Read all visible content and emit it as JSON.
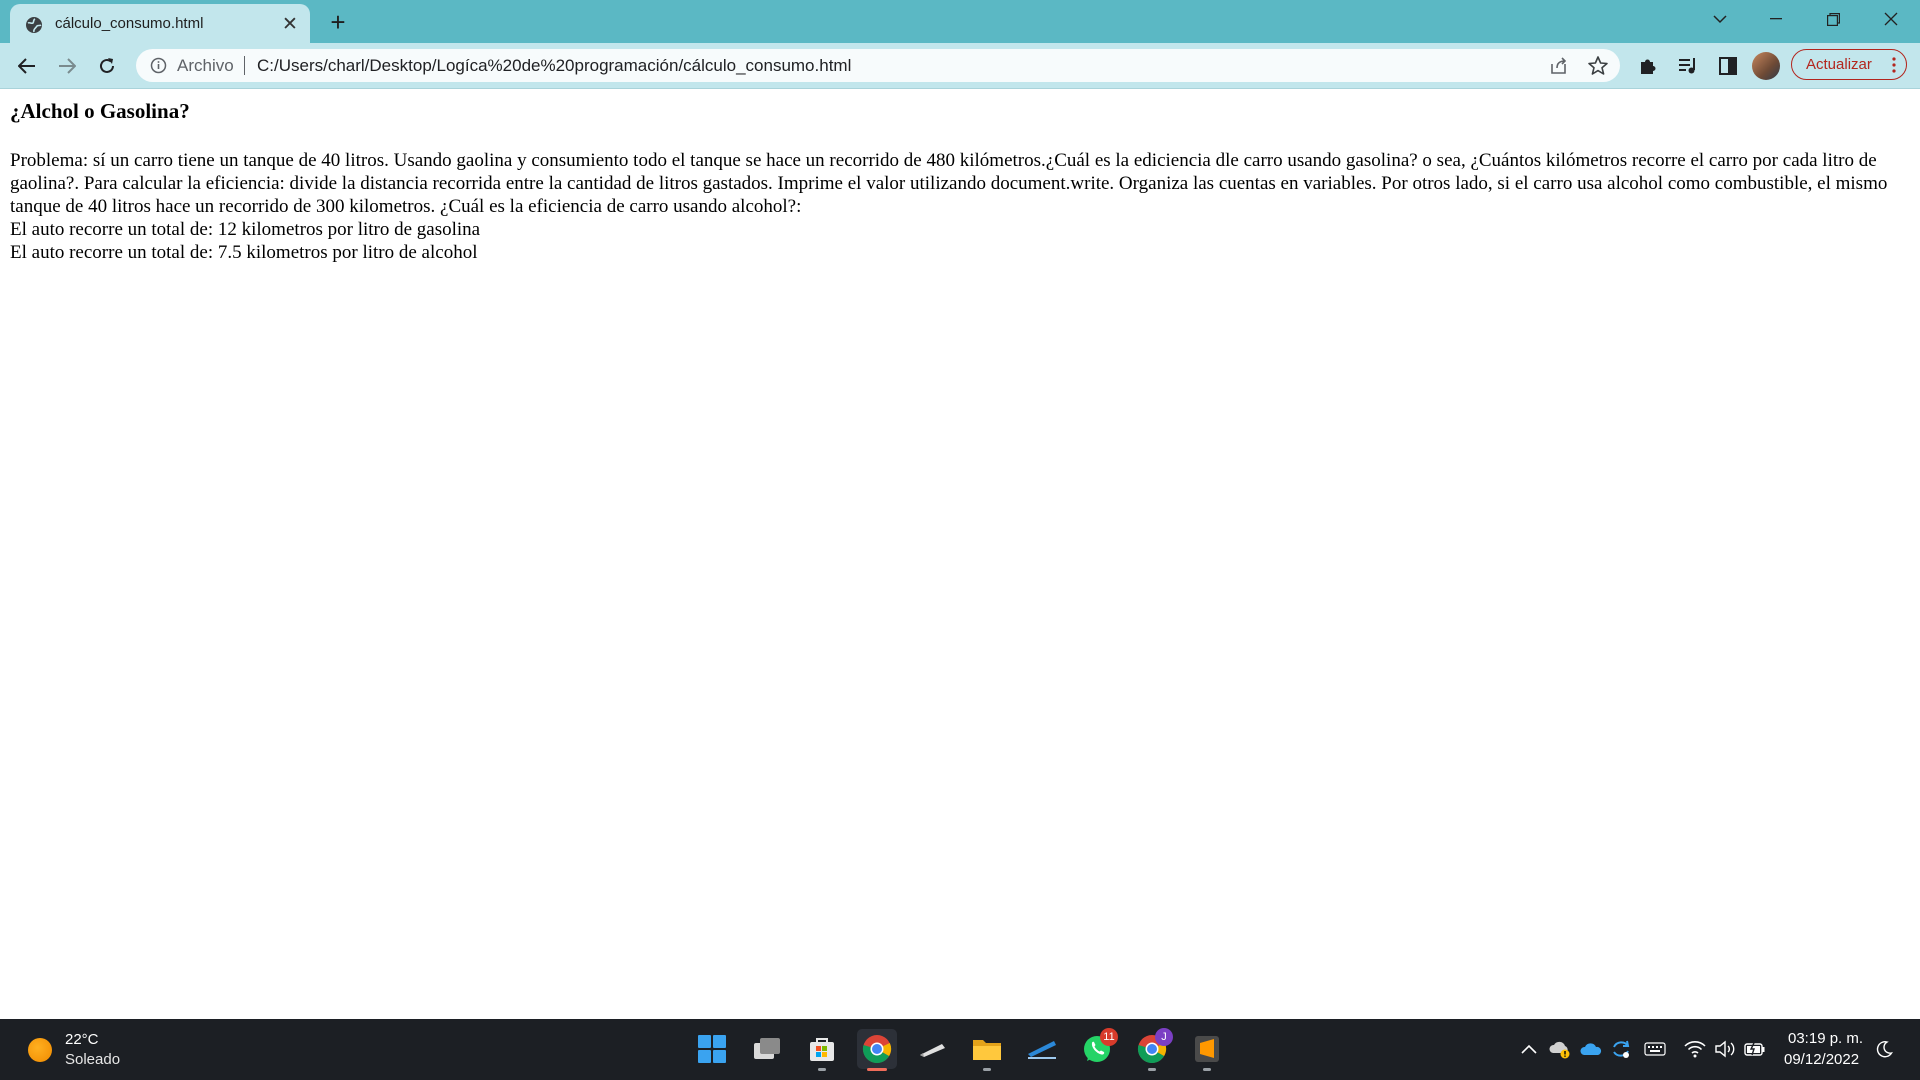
{
  "browser": {
    "tab": {
      "title": "cálculo_consumo.html",
      "favicon": "globe-icon"
    },
    "address_bar": {
      "scheme_label": "Archivo",
      "url": "C:/Users/charl/Desktop/Logíca%20de%20programación/cálculo_consumo.html"
    },
    "update_button_label": "Actualizar",
    "colors": {
      "tab_strip": "#5bb8c4",
      "toolbar": "#c2e6ec",
      "update_accent": "#b3261e"
    }
  },
  "page": {
    "heading": "¿Alchol o Gasolina?",
    "problem": "Problema: sí un carro tiene un tanque de 40 litros. Usando gaolina y consumiento todo el tanque se hace un recorrido de 480 kilómetros.¿Cuál es la ediciencia dle carro usando gasolina? o sea, ¿Cuántos kilómetros recorre el carro por cada litro de gaolina?. Para calcular la eficiencia: divide la distancia recorrida entre la cantidad de litros gastados. Imprime el valor utilizando document.write. Organiza las cuentas en variables. Por otros lado, si el carro usa alcohol como combustible, el mismo tanque de 40 litros hace un recorrido de 300 kilometros. ¿Cuál es la eficiencia de carro usando alcohol?:",
    "result_gasoline": "El auto recorre un total de: 12 kilometros por litro de gasolina",
    "result_alcohol": "El auto recorre un total de: 7.5 kilometros por litro de alcohol"
  },
  "taskbar": {
    "weather": {
      "temperature": "22°C",
      "condition": "Soleado",
      "icon": "sun-icon"
    },
    "apps": [
      {
        "name": "windows-start-icon"
      },
      {
        "name": "task-view-icon"
      },
      {
        "name": "microsoft-store-icon"
      },
      {
        "name": "chrome-icon",
        "active": true
      },
      {
        "name": "cloud-app-icon"
      },
      {
        "name": "file-explorer-icon"
      },
      {
        "name": "stylus-app-icon"
      },
      {
        "name": "whatsapp-icon",
        "badge": "11"
      },
      {
        "name": "chrome-profile-icon",
        "badge": "J"
      },
      {
        "name": "sublime-text-icon"
      }
    ],
    "clock": {
      "time": "03:19 p. m.",
      "date": "09/12/2022"
    }
  }
}
